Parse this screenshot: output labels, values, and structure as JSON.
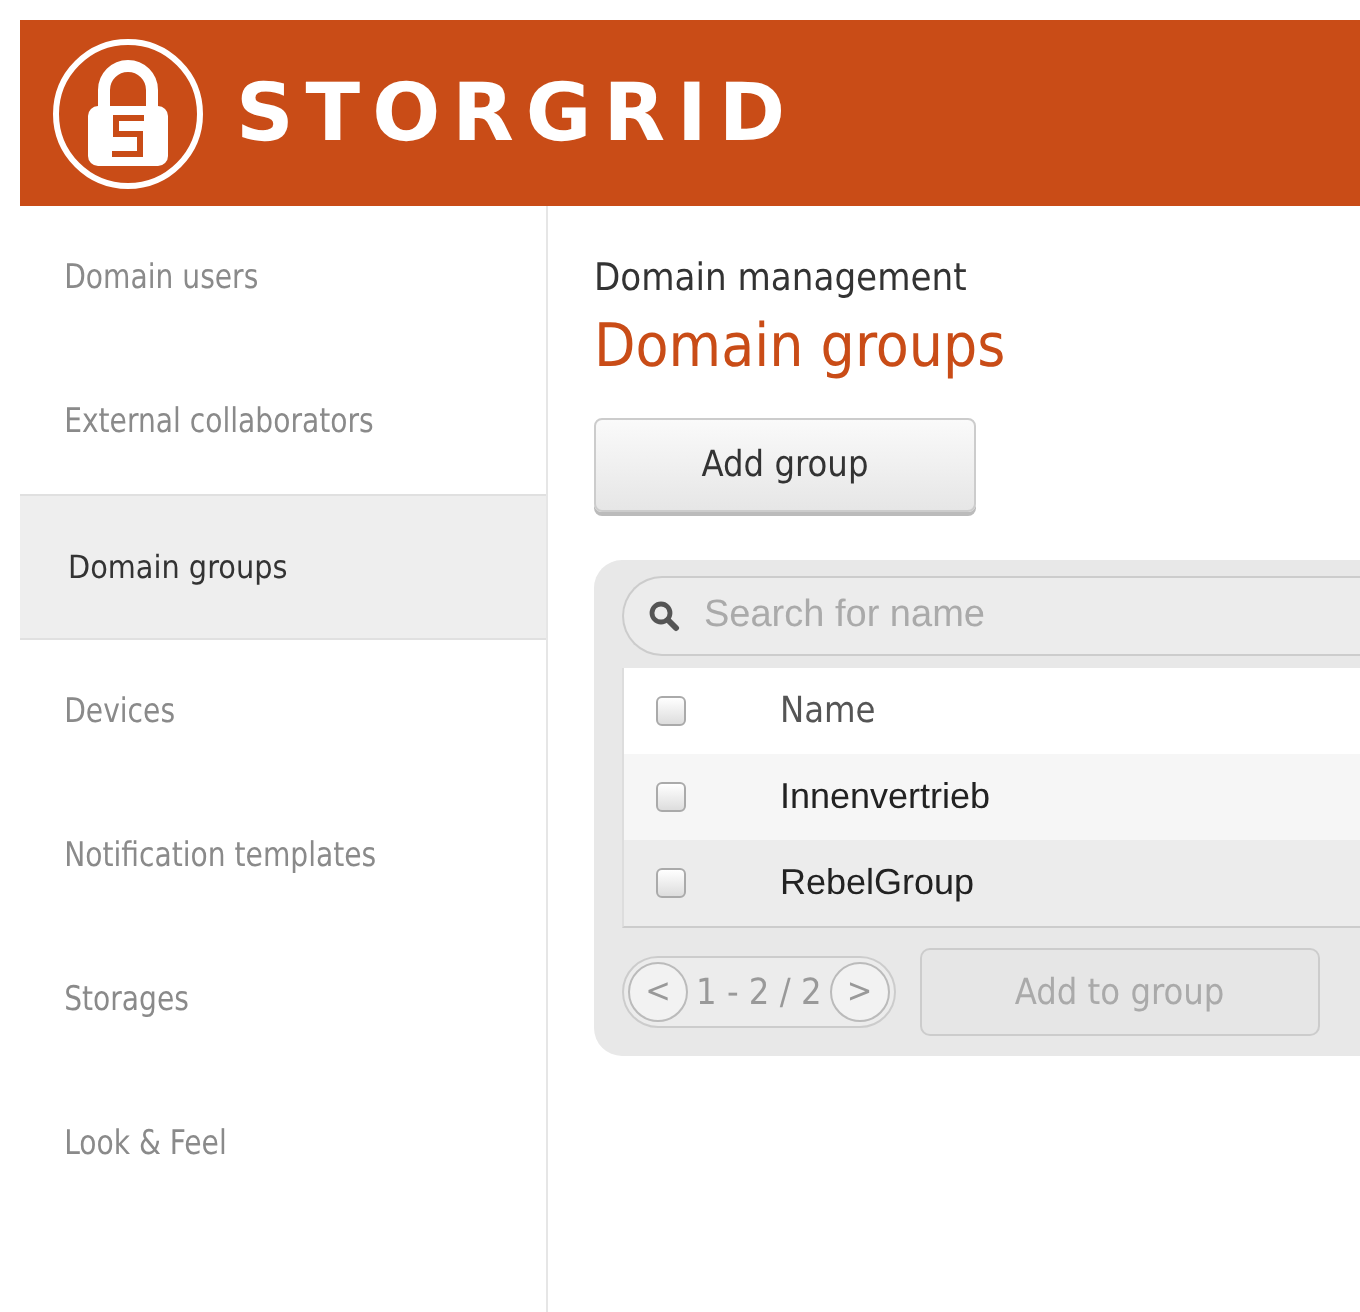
{
  "header": {
    "logo_text": "STORGRID"
  },
  "sidebar": {
    "items": [
      {
        "label": "Domain users",
        "selected": false
      },
      {
        "label": "External collaborators",
        "selected": false
      },
      {
        "label": "Domain groups",
        "selected": true
      },
      {
        "label": "Devices",
        "selected": false
      },
      {
        "label": "Notification templates",
        "selected": false
      },
      {
        "label": "Storages",
        "selected": false
      },
      {
        "label": "Look & Feel",
        "selected": false
      }
    ]
  },
  "main": {
    "breadcrumb": "Domain management",
    "title": "Domain groups",
    "add_button": "Add group",
    "search": {
      "placeholder": "Search for name"
    },
    "table": {
      "header_checked": false,
      "columns": [
        "Name"
      ],
      "rows": [
        {
          "name": "Innenvertrieb",
          "checked": false
        },
        {
          "name": "RebelGroup",
          "checked": false
        }
      ]
    },
    "pager": {
      "prev": "<",
      "range": "1 - 2 / 2",
      "next": ">"
    },
    "add_to_group": {
      "label": "Add to group",
      "disabled": true
    }
  }
}
